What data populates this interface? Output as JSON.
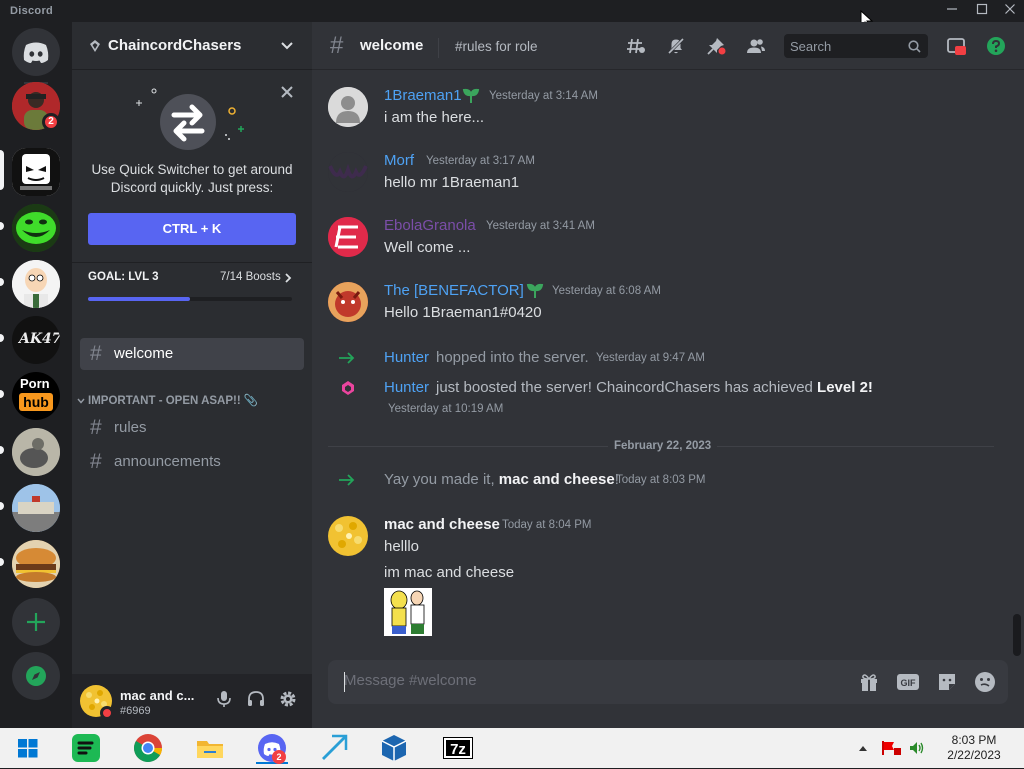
{
  "window": {
    "app_title": "Discord",
    "controls": [
      "minimize",
      "maximize",
      "close"
    ]
  },
  "servers": [
    {
      "name": "direct-messages",
      "icon": "discord-logo"
    },
    {
      "name": "server-red-avatar",
      "badge": "2"
    },
    {
      "name": "server-face-sketch"
    },
    {
      "name": "server-trollface"
    },
    {
      "name": "server-peter-griffin"
    },
    {
      "name": "server-ak47",
      "text": "AK47"
    },
    {
      "name": "server-ph",
      "text_top": "Porn",
      "text_bottom": "hub"
    },
    {
      "name": "server-photo"
    },
    {
      "name": "server-building"
    },
    {
      "name": "server-burger"
    }
  ],
  "rail_actions": {
    "add_server": "+",
    "explore": "compass"
  },
  "sidebar": {
    "guild_name": "ChaincordChasers",
    "quick_switcher": {
      "text": "Use Quick Switcher to get around Discord quickly. Just press:",
      "button": "CTRL + K"
    },
    "boost_goal": {
      "label": "GOAL: LVL 3",
      "count": "7/14 Boosts",
      "progress": 0.5
    },
    "channels_top": [
      {
        "name": "welcome",
        "selected": true
      }
    ],
    "category": "IMPORTANT - OPEN ASAP!! 📎",
    "channels": [
      {
        "name": "rules"
      },
      {
        "name": "announcements"
      }
    ]
  },
  "user": {
    "name": "mac and c...",
    "tag": "#6969"
  },
  "chat": {
    "channel_name": "welcome",
    "topic": "#rules for role",
    "search_placeholder": "Search",
    "messages": [
      {
        "author": "1Braeman1",
        "time": "Yesterday at 3:14 AM",
        "text": "i am the here...",
        "color": "#4ea2f4"
      },
      {
        "author": "Morf",
        "time": "Yesterday at 3:17 AM",
        "text": "hello mr 1Braeman1",
        "color": "#4ea2f4"
      },
      {
        "author": "EbolaGranola",
        "time": "Yesterday at 3:41 AM",
        "text": "Well come ...",
        "color": "#7b4ea8"
      },
      {
        "author": "The [BENEFACTOR]",
        "time": "Yesterday at 6:08 AM",
        "text": "Hello 1Braeman1#0420",
        "color": "#4ea2f4"
      }
    ],
    "system": [
      {
        "author": "Hunter",
        "text": "hopped into the server.",
        "time": "Yesterday at 9:47 AM"
      },
      {
        "author": "Hunter",
        "text_pre": "just boosted the server! ChaincordChasers has achieved",
        "text_bold": "Level 2!",
        "time": "Yesterday at 10:19 AM"
      }
    ],
    "divider_date": "February 22, 2023",
    "welcome_system": {
      "pre": "Yay you made it,",
      "bold": "mac and cheese",
      "post": "!",
      "time": "Today at 8:03 PM"
    },
    "last_message": {
      "author": "mac and cheese",
      "time": "Today at 8:04 PM",
      "lines": [
        "helllo",
        "im mac and cheese"
      ]
    },
    "composer_placeholder": "Message #welcome"
  },
  "taskbar": {
    "apps": [
      "start",
      "spotify",
      "chrome",
      "file-explorer",
      "discord",
      "app-blue",
      "virtualbox",
      "7zip"
    ],
    "discord_badge": "2",
    "sevenzip_label": "7z",
    "time": "8:03 PM",
    "date": "2/22/2023"
  },
  "colors": {
    "accent": "#5865f2",
    "boost_pink": "#eb459f",
    "green": "#23a55a"
  }
}
